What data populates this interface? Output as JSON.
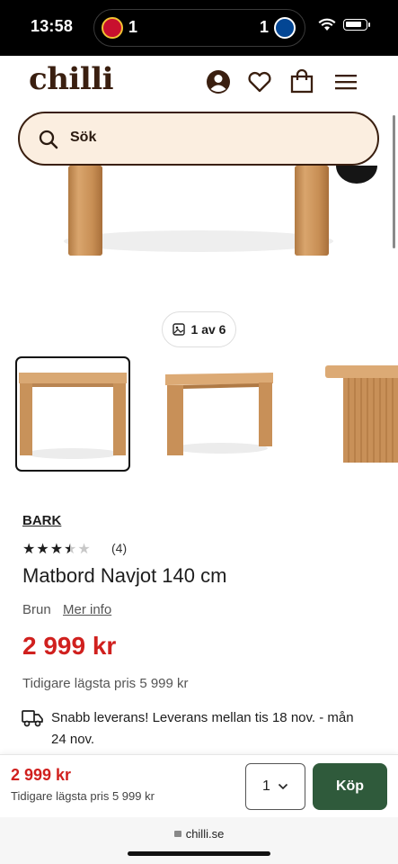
{
  "status": {
    "time": "13:58",
    "score_home": "1",
    "score_away": "1"
  },
  "header": {
    "logo": "chilli"
  },
  "search": {
    "placeholder": "Sök"
  },
  "gallery": {
    "counter": "1 av 6"
  },
  "product": {
    "brand": "BARK",
    "rating": 3.5,
    "rating_max": 5,
    "reviews": "(4)",
    "title": "Matbord Navjot 140 cm",
    "color": "Brun",
    "more_info": "Mer info",
    "price": "2 999 kr",
    "previous_price": "Tidigare lägsta pris 5 999 kr",
    "delivery": "Snabb leverans! Leverans mellan tis 18 nov. - mån 24 nov."
  },
  "sticky": {
    "price": "2 999 kr",
    "previous_price": "Tidigare lägsta pris 5 999 kr",
    "quantity": "1",
    "buy_label": "Köp"
  },
  "browser": {
    "url": "chilli.se"
  },
  "colors": {
    "brand": "#3a1f10",
    "price": "#d0201e",
    "buy": "#2f5a3b",
    "search_bg": "#fbeee0"
  }
}
